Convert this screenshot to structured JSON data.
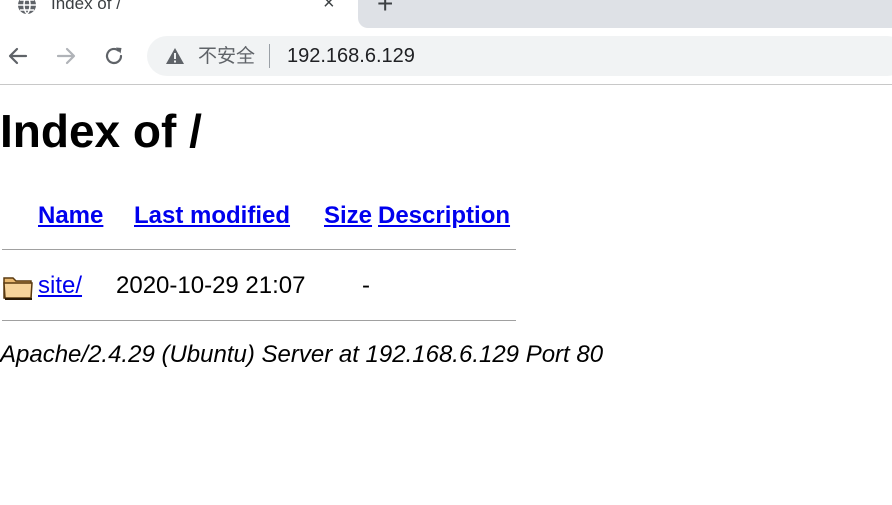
{
  "browser": {
    "tab_title": "Index of /",
    "tab_close": "×",
    "new_tab": "+",
    "security_label": "不安全",
    "url": "192.168.6.129"
  },
  "page": {
    "title": "Index of /",
    "columns": {
      "name": "Name",
      "last_modified": "Last modified",
      "size": "Size",
      "description": "Description"
    },
    "rows": [
      {
        "name": "site/",
        "last_modified": "2020-10-29 21:07",
        "size": "-",
        "description": "",
        "icon": "folder-icon"
      }
    ],
    "footer": "Apache/2.4.29 (Ubuntu) Server at 192.168.6.129 Port 80"
  },
  "colors": {
    "link": "#0000ee",
    "tab_strip": "#dee1e6",
    "omnibox": "#f1f3f4"
  }
}
